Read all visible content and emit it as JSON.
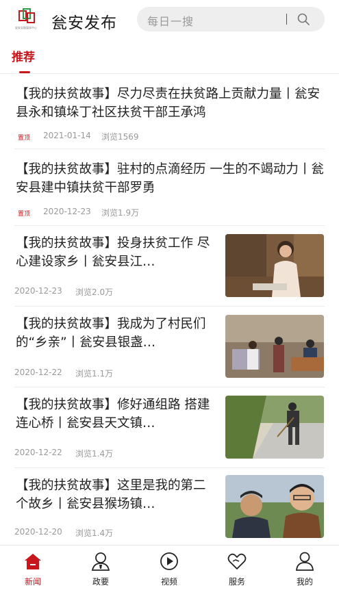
{
  "header": {
    "logo_caption": "瓮安县融媒体中心",
    "app_title": "瓮安发布",
    "search_placeholder": "每日一搜"
  },
  "tabs": [
    {
      "label": "推荐",
      "active": true
    }
  ],
  "feed": [
    {
      "title": "【我的扶贫故事】尽力尽责在扶贫路上贡献力量丨瓮安县永和镇垛丁社区扶贫干部王承鸿",
      "pin": "置顶",
      "date": "2021-01-14",
      "views": "浏览1569",
      "has_image": false
    },
    {
      "title": "【我的扶贫故事】驻村的点滴经历 一生的不竭动力丨瓮安县建中镇扶贫干部罗勇",
      "pin": "置顶",
      "date": "2020-12-23",
      "views": "浏览1.9万",
      "has_image": false
    },
    {
      "title": "【我的扶贫故事】投身扶贫工作 尽心建设家乡丨瓮安县江…",
      "date": "2020-12-23",
      "views": "浏览2.0万",
      "has_image": true
    },
    {
      "title": "【我的扶贫故事】我成为了村民们的“乡亲”丨瓮安县银盏…",
      "date": "2020-12-22",
      "views": "浏览1.1万",
      "has_image": true
    },
    {
      "title": "【我的扶贫故事】修好通组路 搭建连心桥丨瓮安县天文镇…",
      "date": "2020-12-22",
      "views": "浏览1.4万",
      "has_image": true
    },
    {
      "title": "【我的扶贫故事】这里是我的第二个故乡丨瓮安县猴场镇…",
      "date": "2020-12-20",
      "views": "浏览1.4万",
      "has_image": true
    }
  ],
  "bottom_nav": [
    {
      "label": "新闻",
      "icon": "home-icon",
      "active": true
    },
    {
      "label": "政要",
      "icon": "person-badge-icon",
      "active": false
    },
    {
      "label": "视频",
      "icon": "play-circle-icon",
      "active": false
    },
    {
      "label": "服务",
      "icon": "heart-hand-icon",
      "active": false
    },
    {
      "label": "我的",
      "icon": "user-icon",
      "active": false
    }
  ],
  "colors": {
    "accent": "#c8161d",
    "meta_text": "#999999",
    "search_bg": "#eeeeee"
  }
}
